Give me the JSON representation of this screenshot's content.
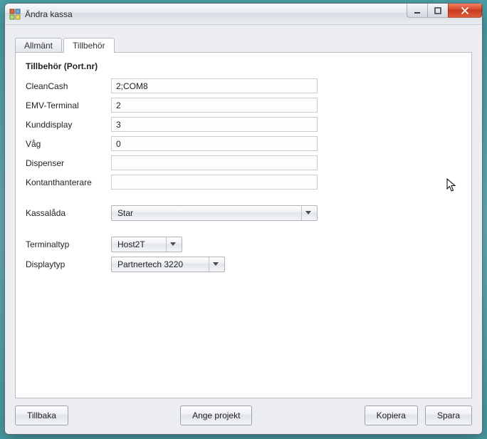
{
  "window": {
    "title": "Ändra kassa"
  },
  "tabs": {
    "general": "Allmänt",
    "accessories": "Tillbehör"
  },
  "section": {
    "title": "Tillbehör (Port.nr)"
  },
  "fields": {
    "cleancash": {
      "label": "CleanCash",
      "value": "2;COM8"
    },
    "emv": {
      "label": "EMV-Terminal",
      "value": "2"
    },
    "kunddisplay": {
      "label": "Kunddisplay",
      "value": "3"
    },
    "vag": {
      "label": "Våg",
      "value": "0"
    },
    "dispenser": {
      "label": "Dispenser",
      "value": ""
    },
    "kontant": {
      "label": "Kontanthanterare",
      "value": ""
    }
  },
  "selects": {
    "kassalada": {
      "label": "Kassalåda",
      "value": "Star"
    },
    "terminaltyp": {
      "label": "Terminaltyp",
      "value": "Host2T"
    },
    "displaytyp": {
      "label": "Displaytyp",
      "value": "Partnertech 3220"
    }
  },
  "buttons": {
    "back": "Tillbaka",
    "project": "Ange projekt",
    "copy": "Kopiera",
    "save": "Spara"
  }
}
